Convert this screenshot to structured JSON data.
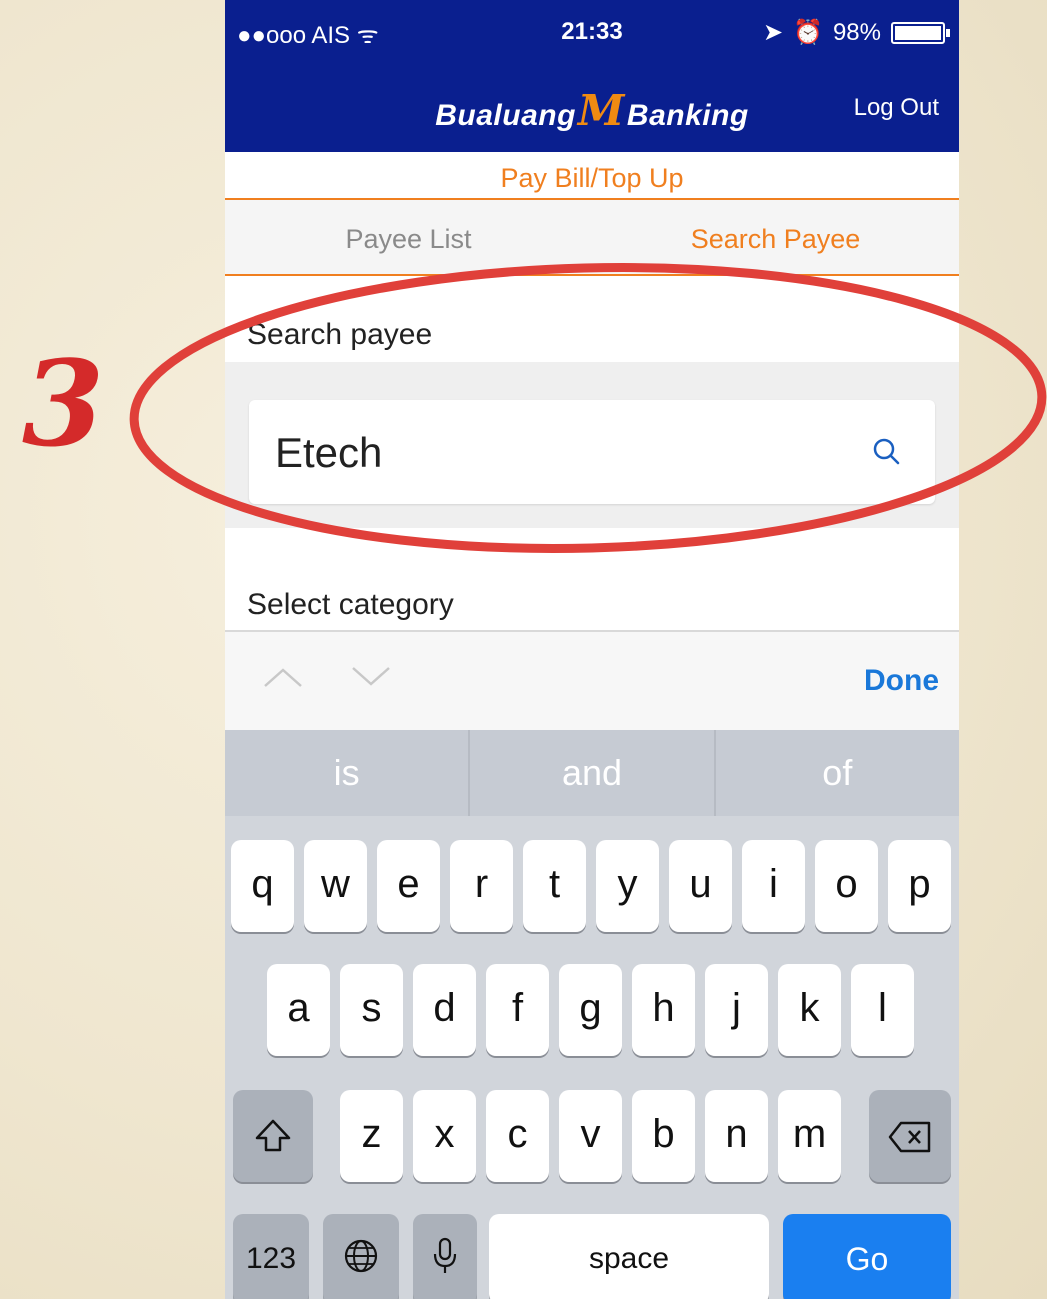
{
  "annotation": {
    "step_number": "3"
  },
  "status_bar": {
    "carrier": "●●ooo AIS ᯤ",
    "time": "21:33",
    "battery_percent": "98%",
    "battery_level": 0.98
  },
  "header": {
    "logo_left": "Bualuang",
    "logo_m": "M",
    "logo_right": "Banking",
    "logout_label": "Log Out"
  },
  "page": {
    "section_title": "Pay Bill/Top Up"
  },
  "tabs": [
    {
      "label": "Payee List",
      "active": false
    },
    {
      "label": "Search Payee",
      "active": true
    }
  ],
  "search": {
    "label": "Search payee",
    "value": "Etech"
  },
  "category": {
    "label": "Select category"
  },
  "accessory": {
    "done_label": "Done"
  },
  "suggestions": [
    "is",
    "and",
    "of"
  ],
  "keyboard": {
    "row1": [
      "q",
      "w",
      "e",
      "r",
      "t",
      "y",
      "u",
      "i",
      "o",
      "p"
    ],
    "row2": [
      "a",
      "s",
      "d",
      "f",
      "g",
      "h",
      "j",
      "k",
      "l"
    ],
    "row3": [
      "z",
      "x",
      "c",
      "v",
      "b",
      "n",
      "m"
    ],
    "numbers_label": "123",
    "space_label": "space",
    "go_label": "Go"
  },
  "colors": {
    "header_bg": "#0a1f8f",
    "accent": "#f07f1f",
    "annotation": "#d42a2a",
    "go_button": "#1a7ff0"
  }
}
